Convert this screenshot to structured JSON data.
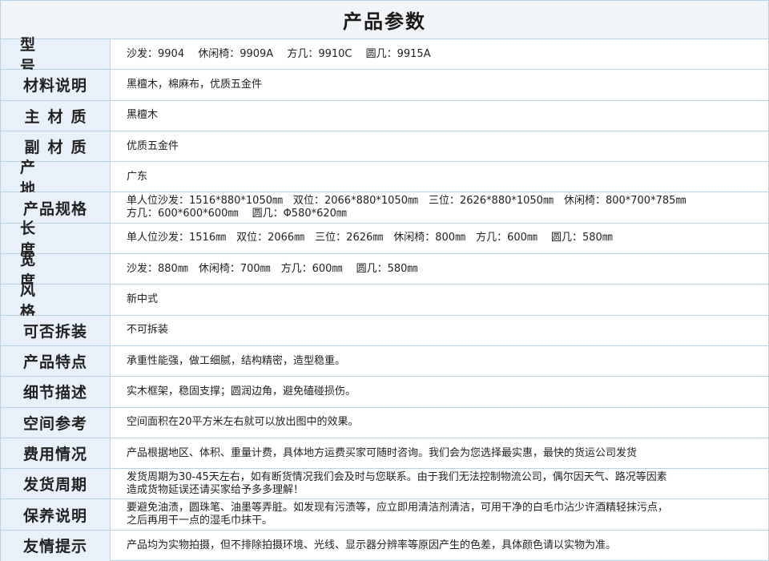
{
  "title": "产品参数",
  "rows": [
    {
      "label": "型　号",
      "value": "沙发：9904　 休闲椅：9909A　 方几：9910C　 圆几：9915A"
    },
    {
      "label": "材料说明",
      "value": "黑檀木，棉麻布，优质五金件"
    },
    {
      "label": "主材质",
      "value": "黑檀木"
    },
    {
      "label": "副材质",
      "value": "优质五金件"
    },
    {
      "label": "产　地",
      "value": "广东"
    },
    {
      "label": "产品规格",
      "value": "单人位沙发：1516*880*1050㎜　双位：2066*880*1050㎜　三位：2626*880*1050㎜　休闲椅：800*700*785㎜\n方几：600*600*600㎜　 圆几：Φ580*620㎜"
    },
    {
      "label": "长　度",
      "value": "单人位沙发：1516㎜　双位：2066㎜　三位：2626㎜　休闲椅：800㎜　方几：600㎜　 圆几：580㎜"
    },
    {
      "label": "宽　度",
      "value": "沙发：880㎜　休闲椅：700㎜　方几：600㎜　 圆几：580㎜"
    },
    {
      "label": "风　格",
      "value": "新中式"
    },
    {
      "label": "可否拆装",
      "value": "不可拆装"
    },
    {
      "label": "产品特点",
      "value": "承重性能强，做工细腻，结构精密，造型稳重。"
    },
    {
      "label": "细节描述",
      "value": "实木框架，稳固支撑；圆润边角，避免磕碰损伤。"
    },
    {
      "label": "空间参考",
      "value": "空间面积在20平方米左右就可以放出图中的效果。"
    },
    {
      "label": "费用情况",
      "value": "产品根据地区、体积、重量计费，具体地方运费买家可随时咨询。我们会为您选择最实惠，最快的货运公司发货"
    },
    {
      "label": "发货周期",
      "value": "发货周期为30-45天左右，如有断货情况我们会及时与您联系。由于我们无法控制物流公司，偶尔因天气、路况等因素\n造成货物延误还请买家给予多多理解！"
    },
    {
      "label": "保养说明",
      "value": "要避免油渍，圆珠笔、油墨等弄脏。如发现有污渍等，应立即用清洁剂清洁，可用干净的白毛巾沾少许酒精轻抹污点，\n之后再用干一点的湿毛巾抹干。"
    },
    {
      "label": "友情提示",
      "value": "产品均为实物拍摄，但不排除拍摄环境、光线、显示器分辨率等原因产生的色差，具体颜色请以实物为准。"
    }
  ]
}
